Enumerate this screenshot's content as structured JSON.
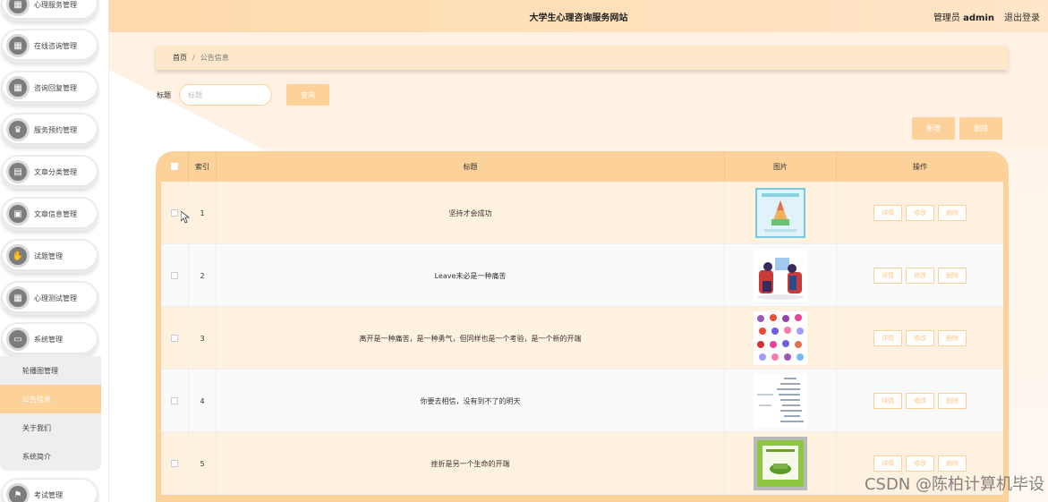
{
  "header": {
    "site_title": "大学生心理咨询服务网站",
    "user_role": "管理员",
    "user_name": "admin",
    "logout": "退出登录"
  },
  "sidebar": {
    "items": [
      {
        "label": "心理服务管理",
        "icon": "grid-icon"
      },
      {
        "label": "在线咨询管理",
        "icon": "grid-icon"
      },
      {
        "label": "咨询回复管理",
        "icon": "grid-icon"
      },
      {
        "label": "服务预约管理",
        "icon": "trophy-icon"
      },
      {
        "label": "文章分类管理",
        "icon": "briefcase-icon"
      },
      {
        "label": "文章信息管理",
        "icon": "document-icon"
      },
      {
        "label": "试题管理",
        "icon": "thumbs-up-icon"
      },
      {
        "label": "心理测试管理",
        "icon": "grid-icon"
      },
      {
        "label": "系统管理",
        "icon": "ticket-icon"
      },
      {
        "label": "考试管理",
        "icon": "flag-icon"
      }
    ],
    "submenu": [
      {
        "label": "轮播图管理"
      },
      {
        "label": "公告信息"
      },
      {
        "label": "关于我们"
      },
      {
        "label": "系统简介"
      }
    ]
  },
  "breadcrumb": {
    "home": "首页",
    "separator": "/",
    "current": "公告信息"
  },
  "search": {
    "label": "标题",
    "placeholder": "标题",
    "button": "查询"
  },
  "toolbar": {
    "add": "新增",
    "delete": "删除"
  },
  "table": {
    "headers": {
      "index": "索引",
      "title": "标题",
      "image": "图片",
      "actions": "操作"
    },
    "actions": {
      "detail": "详情",
      "edit": "修改",
      "delete": "删除"
    },
    "rows": [
      {
        "index": "1",
        "title": "坚持才会成功"
      },
      {
        "index": "2",
        "title": "Leave未必是一种痛苦"
      },
      {
        "index": "3",
        "title": "离开是一种痛苦，是一种勇气，但同样也是一个考验，是一个新的开端"
      },
      {
        "index": "4",
        "title": "你要去相信，没有到不了的明天"
      },
      {
        "index": "5",
        "title": "挫折是另一个生命的开端"
      }
    ]
  },
  "watermark": "CSDN @陈柏计算机毕设",
  "colors": {
    "accent": "#fdd29a",
    "header": "#fed9ab"
  }
}
